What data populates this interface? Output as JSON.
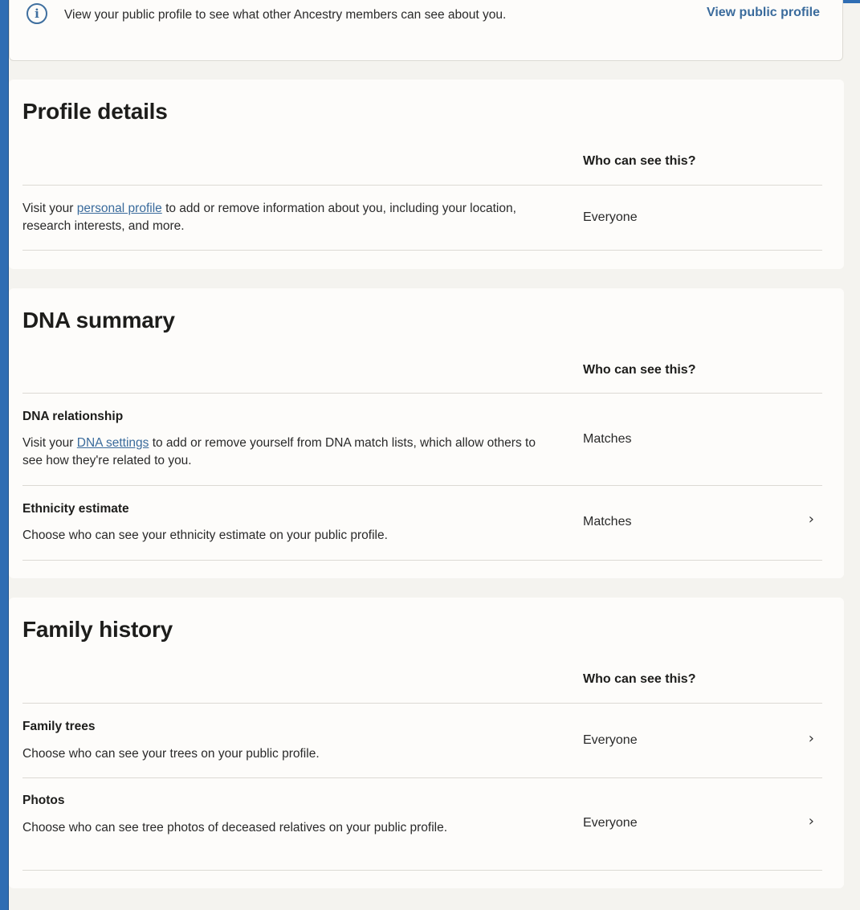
{
  "banner": {
    "text": "View your public profile to see what other Ancestry members can see about you.",
    "link": "View public profile",
    "icon": "info-icon"
  },
  "profile_details": {
    "title": "Profile details",
    "column_header": "Who can see this?",
    "row": {
      "desc_prefix": "Visit your ",
      "link": "personal profile",
      "desc_suffix": " to add or remove information about you, including your location, research interests, and more.",
      "value": "Everyone"
    }
  },
  "dna_summary": {
    "title": "DNA summary",
    "column_header": "Who can see this?",
    "rows": [
      {
        "title": "DNA relationship",
        "desc_prefix": "Visit your ",
        "link": "DNA settings",
        "desc_suffix": " to add or remove yourself from DNA match lists, which allow others to see how they're related to you.",
        "value": "Matches"
      },
      {
        "title": "Ethnicity estimate",
        "desc": "Choose who can see your ethnicity estimate on your public profile.",
        "value": "Matches"
      }
    ]
  },
  "family_history": {
    "title": "Family history",
    "column_header": "Who can see this?",
    "rows": [
      {
        "title": "Family trees",
        "desc": "Choose who can see your trees on your public profile.",
        "value": "Everyone"
      },
      {
        "title": "Photos",
        "desc": "Choose who can see tree photos of deceased relatives on your public profile.",
        "value": "Everyone"
      }
    ]
  },
  "icons": {
    "chevron": "›",
    "info": "i"
  },
  "colors": {
    "link": "#3a6b9c",
    "frame": "#2f6db3",
    "background": "#f4f3ef"
  }
}
